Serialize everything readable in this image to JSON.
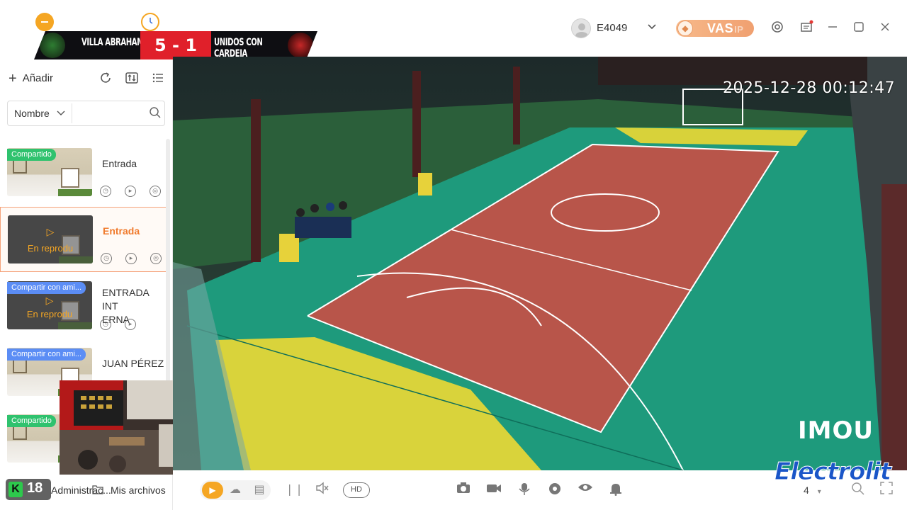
{
  "scorebug": {
    "home_team": "VILLA ABRAHAM",
    "away_team": "UNIDOS CON CARDEJA",
    "score": "5 - 1"
  },
  "header": {
    "user_name": "E4049",
    "vas_label": "VAS",
    "vas_suffix": "IP",
    "accent_color": "#f5a623"
  },
  "sidebar": {
    "add_label": "Añadir",
    "sort_label": "Nombre",
    "search_placeholder": "",
    "items": [
      {
        "name": "Entrada",
        "badge": "Compartido",
        "badge_color": "green",
        "status": "",
        "active": false
      },
      {
        "name": "Entrada",
        "badge": "",
        "badge_color": "",
        "status": "En reprodu",
        "active": true
      },
      {
        "name": "ENTRADA INTERNA",
        "name_line1": "ENTRADA INT",
        "name_line2": "ERNA",
        "badge": "Compartir con ami...",
        "badge_color": "blue",
        "status": "En reprodu",
        "active": false
      },
      {
        "name": "JUAN PÉREZ",
        "badge": "Compartir con ami...",
        "badge_color": "blue",
        "status": "",
        "active": false
      },
      {
        "name": "",
        "badge": "Compartido",
        "badge_color": "green",
        "status": "",
        "active": false
      }
    ],
    "admin_label": "Administrac...",
    "files_label": "Mis archivos",
    "channel_number": "18",
    "channel_letter": "K"
  },
  "video": {
    "timestamp": "2025-12-28 00:12:47",
    "brand": "IMOU",
    "sponsor": "Electrolit"
  },
  "controls": {
    "hd_label": "HD",
    "grid_value": "4"
  }
}
